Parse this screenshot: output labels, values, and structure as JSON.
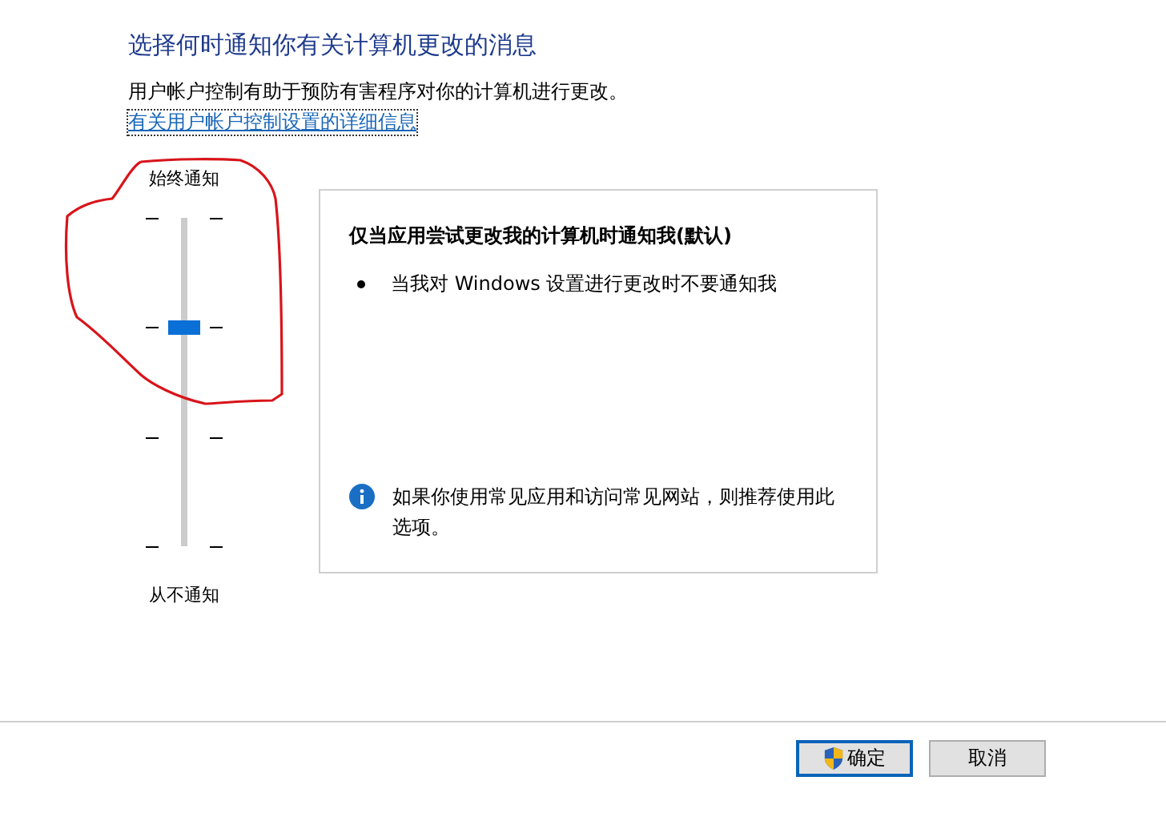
{
  "heading": "选择何时通知你有关计算机更改的消息",
  "description": "用户帐户控制有助于预防有害程序对你的计算机进行更改。",
  "help_link": "有关用户帐户控制设置的详细信息",
  "slider": {
    "top_label": "始终通知",
    "bottom_label": "从不通知",
    "level": 0.667
  },
  "panel": {
    "title": "仅当应用尝试更改我的计算机时通知我(默认)",
    "bullets": [
      "当我对 Windows 设置进行更改时不要通知我"
    ],
    "note": "如果你使用常见应用和访问常见网站，则推荐使用此选项。"
  },
  "buttons": [
    {
      "label": "确定",
      "kind": "primary"
    },
    {
      "label": "取消",
      "kind": "secondary"
    }
  ]
}
